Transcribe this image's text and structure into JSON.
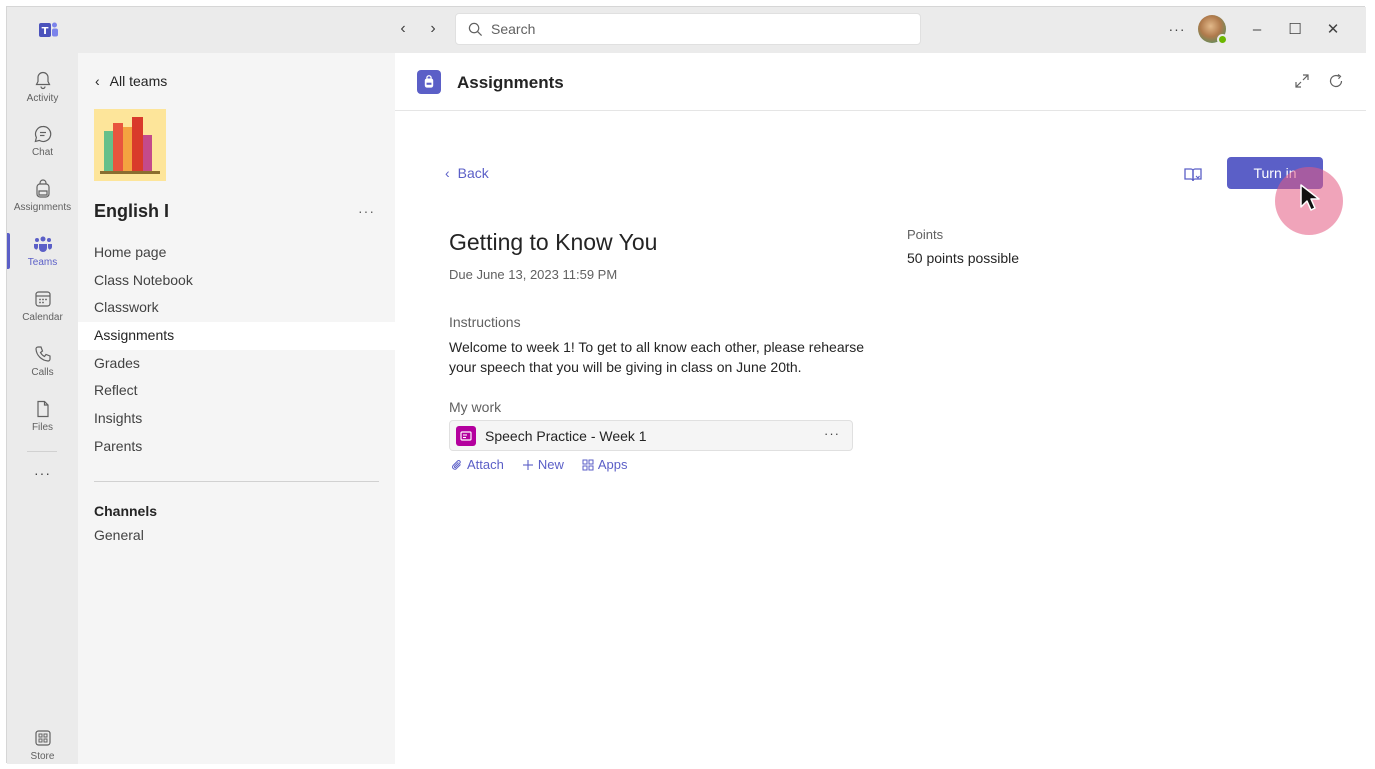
{
  "titlebar": {
    "search_placeholder": "Search",
    "more_label": "···",
    "minimize_label": "–",
    "maximize_label": "☐",
    "close_label": "✕",
    "back_arrow": "‹",
    "forward_arrow": "›"
  },
  "rail": {
    "items": [
      {
        "label": "Activity",
        "icon": "bell-icon"
      },
      {
        "label": "Chat",
        "icon": "chat-icon"
      },
      {
        "label": "Assignments",
        "icon": "backpack-icon"
      },
      {
        "label": "Teams",
        "icon": "teams-icon"
      },
      {
        "label": "Calendar",
        "icon": "calendar-icon"
      },
      {
        "label": "Calls",
        "icon": "phone-icon"
      },
      {
        "label": "Files",
        "icon": "file-icon"
      }
    ],
    "more_label": "···",
    "store_label": "Store"
  },
  "panel": {
    "all_teams": "All teams",
    "team_name": "English I",
    "team_more": "···",
    "nav": [
      "Home page",
      "Class Notebook",
      "Classwork",
      "Assignments",
      "Grades",
      "Reflect",
      "Insights",
      "Parents"
    ],
    "selected_nav": "Assignments",
    "channels_heading": "Channels",
    "channels": [
      "General"
    ]
  },
  "main": {
    "app_title": "Assignments",
    "back_label": "Back",
    "turn_in_label": "Turn in",
    "assignment_title": "Getting to Know You",
    "due": "Due June 13, 2023 11:59 PM",
    "points_label": "Points",
    "points_value": "50 points possible",
    "instructions_label": "Instructions",
    "instructions_text": "Welcome to week 1! To get to all know each other, please rehearse your speech that you will be giving in class on June 20th.",
    "my_work_label": "My work",
    "file_name": "Speech Practice - Week 1",
    "file_more": "···",
    "actions": {
      "attach": "Attach",
      "new": "New",
      "apps": "Apps"
    }
  },
  "colors": {
    "accent": "#5b5fc7",
    "file_icon": "#b4009e",
    "cursor_highlight": "#e45a82"
  }
}
